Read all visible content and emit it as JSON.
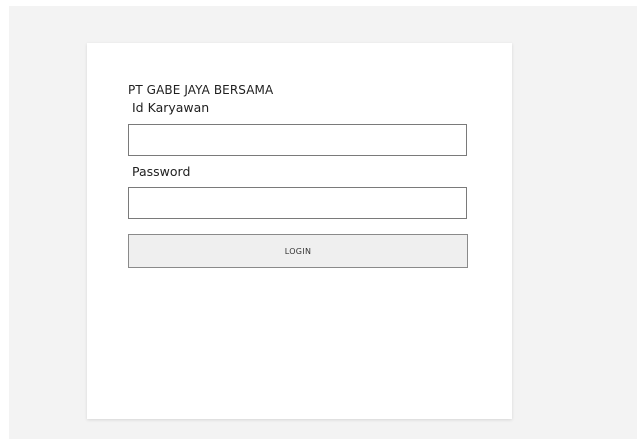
{
  "login_form": {
    "company_name": "PT GABE JAYA BERSAMA",
    "id_label": "Id Karyawan",
    "id_value": "",
    "password_label": "Password",
    "password_value": "",
    "login_label": "LOGIN"
  },
  "colors": {
    "page_background": "#f3f3f3",
    "card_background": "#ffffff",
    "button_background": "#efefef",
    "border": "#7a7a7a"
  }
}
